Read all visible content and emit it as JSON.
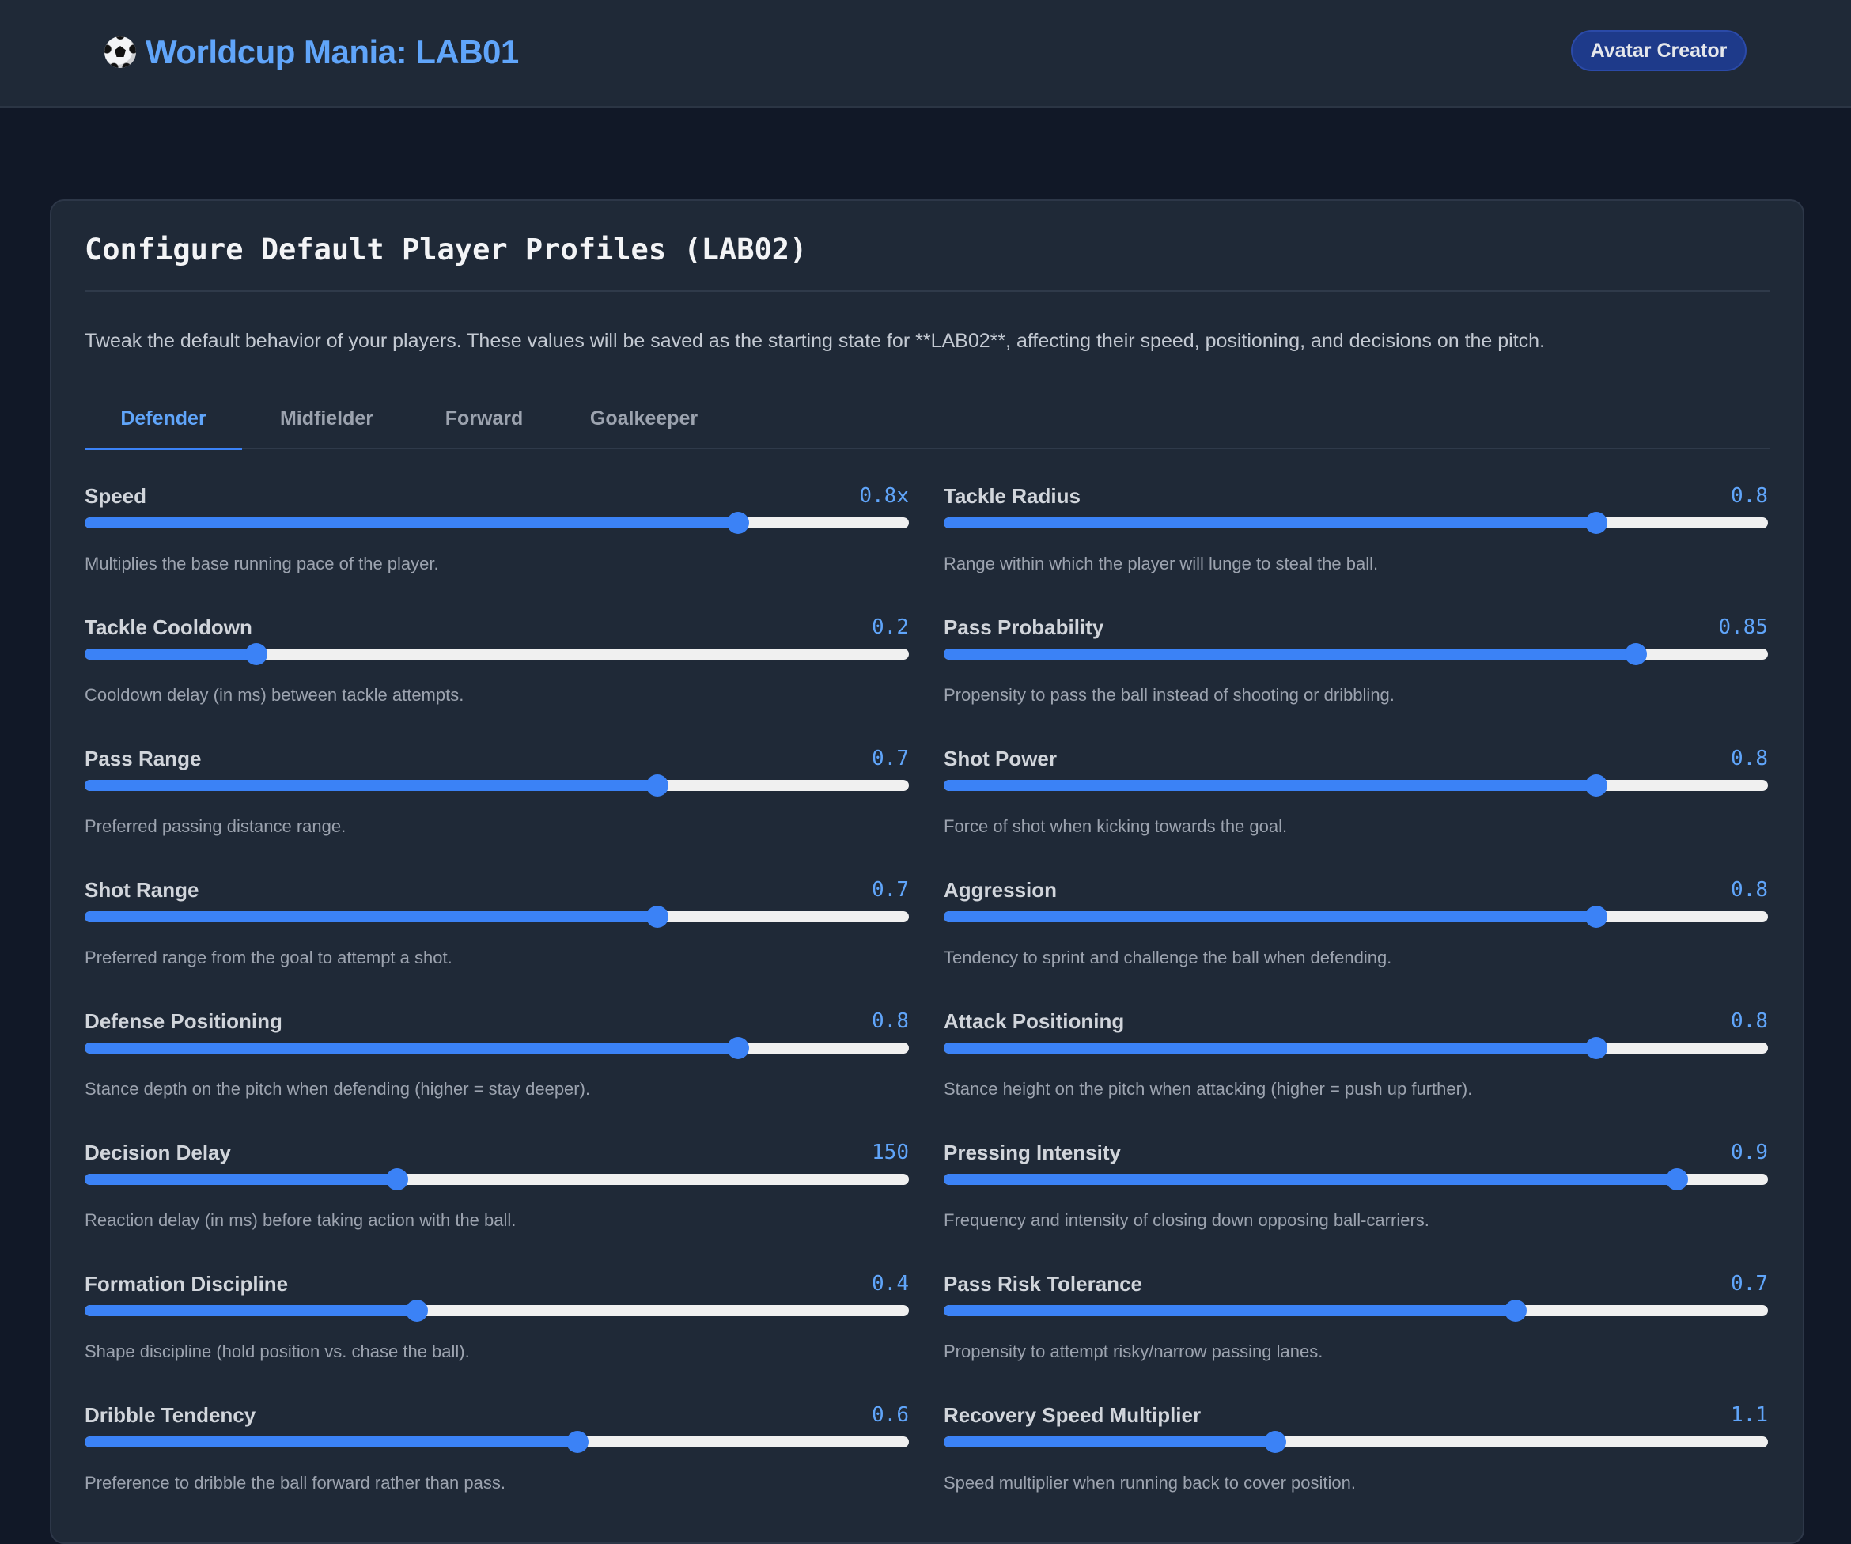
{
  "header": {
    "title": "Worldcup Mania: LAB01",
    "logo_icon": "soccer-ball-icon",
    "avatar_button": "Avatar Creator"
  },
  "panel": {
    "title": "Configure Default Player Profiles (LAB02)",
    "description": "Tweak the default behavior of your players. These values will be saved as the starting state for **LAB02**, affecting their speed, positioning, and decisions on the pitch."
  },
  "tabs": [
    {
      "label": "Defender",
      "active": true
    },
    {
      "label": "Midfielder",
      "active": false
    },
    {
      "label": "Forward",
      "active": false
    },
    {
      "label": "Goalkeeper",
      "active": false
    }
  ],
  "colors": {
    "accent": "#3b82f6",
    "accent_text": "#60a5fa",
    "background": "#111827",
    "panel": "#1f2937"
  },
  "fields": [
    {
      "label": "Speed",
      "value": "0.8x",
      "fill": 0.793,
      "help": "Multiplies the base running pace of the player."
    },
    {
      "label": "Tackle Radius",
      "value": "0.8",
      "fill": 0.792,
      "help": "Range within which the player will lunge to steal the ball."
    },
    {
      "label": "Tackle Cooldown",
      "value": "0.2",
      "fill": 0.208,
      "help": "Cooldown delay (in ms) between tackle attempts."
    },
    {
      "label": "Pass Probability",
      "value": "0.85",
      "fill": 0.84,
      "help": "Propensity to pass the ball instead of shooting or dribbling."
    },
    {
      "label": "Pass Range",
      "value": "0.7",
      "fill": 0.695,
      "help": "Preferred passing distance range."
    },
    {
      "label": "Shot Power",
      "value": "0.8",
      "fill": 0.792,
      "help": "Force of shot when kicking towards the goal."
    },
    {
      "label": "Shot Range",
      "value": "0.7",
      "fill": 0.695,
      "help": "Preferred range from the goal to attempt a shot."
    },
    {
      "label": "Aggression",
      "value": "0.8",
      "fill": 0.792,
      "help": "Tendency to sprint and challenge the ball when defending."
    },
    {
      "label": "Defense Positioning",
      "value": "0.8",
      "fill": 0.793,
      "help": "Stance depth on the pitch when defending (higher = stay deeper)."
    },
    {
      "label": "Attack Positioning",
      "value": "0.8",
      "fill": 0.792,
      "help": "Stance height on the pitch when attacking (higher = push up further)."
    },
    {
      "label": "Decision Delay",
      "value": "150",
      "fill": 0.379,
      "help": "Reaction delay (in ms) before taking action with the ball."
    },
    {
      "label": "Pressing Intensity",
      "value": "0.9",
      "fill": 0.89,
      "help": "Frequency and intensity of closing down opposing ball-carriers."
    },
    {
      "label": "Formation Discipline",
      "value": "0.4",
      "fill": 0.403,
      "help": "Shape discipline (hold position vs. chase the ball)."
    },
    {
      "label": "Pass Risk Tolerance",
      "value": "0.7",
      "fill": 0.694,
      "help": "Propensity to attempt risky/narrow passing lanes."
    },
    {
      "label": "Dribble Tendency",
      "value": "0.6",
      "fill": 0.598,
      "help": "Preference to dribble the ball forward rather than pass."
    },
    {
      "label": "Recovery Speed Multiplier",
      "value": "1.1",
      "fill": 0.402,
      "help": "Speed multiplier when running back to cover position."
    }
  ]
}
